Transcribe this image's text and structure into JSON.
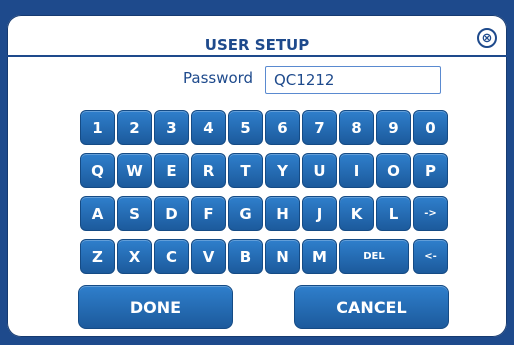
{
  "dialog": {
    "title": "USER SETUP",
    "close_icon": "⊗"
  },
  "password": {
    "label": "Password",
    "value": "QC1212"
  },
  "keyboard": {
    "row1": [
      "1",
      "2",
      "3",
      "4",
      "5",
      "6",
      "7",
      "8",
      "9",
      "0"
    ],
    "row2": [
      "Q",
      "W",
      "E",
      "R",
      "T",
      "Y",
      "U",
      "I",
      "O",
      "P"
    ],
    "row3": [
      "A",
      "S",
      "D",
      "F",
      "G",
      "H",
      "J",
      "K",
      "L",
      "->"
    ],
    "row4": [
      "Z",
      "X",
      "C",
      "V",
      "B",
      "N",
      "M",
      "DEL",
      "<-"
    ]
  },
  "actions": {
    "done_label": "DONE",
    "cancel_label": "CANCEL"
  }
}
